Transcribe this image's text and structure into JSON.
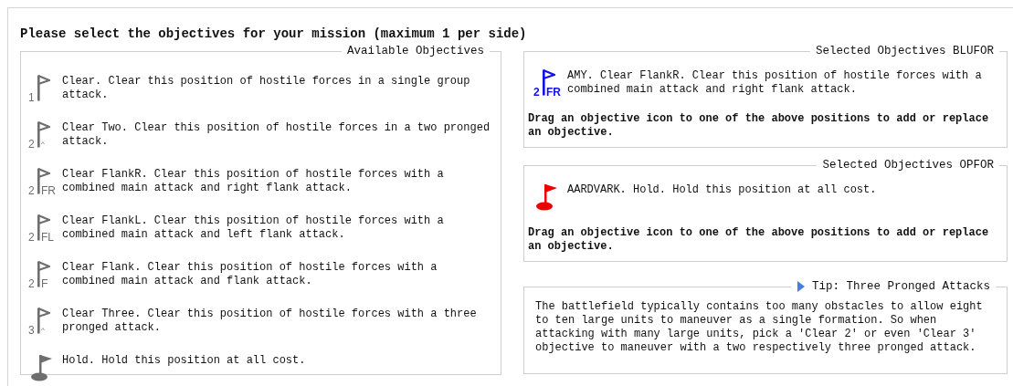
{
  "title": "Please select the objectives for your mission (maximum 1 per side)",
  "available": {
    "legend": "Available Objectives",
    "items": [
      {
        "kind": "clear",
        "number": "1",
        "text": "Clear. Clear this position of hostile forces in a single group attack."
      },
      {
        "kind": "clear",
        "number": "2",
        "suffix": "^",
        "text": "Clear Two. Clear this position of hostile forces in a two pronged attack."
      },
      {
        "kind": "clear",
        "number": "2",
        "suffix": "FR",
        "text": "Clear FlankR. Clear this position of hostile forces with a combined main attack and right flank attack."
      },
      {
        "kind": "clear",
        "number": "2",
        "suffix": "FL",
        "text": "Clear FlankL. Clear this position of hostile forces with a combined main attack and left flank attack."
      },
      {
        "kind": "clear",
        "number": "2",
        "suffix": "F",
        "text": "Clear Flank. Clear this position of hostile forces with a combined main attack and flank attack."
      },
      {
        "kind": "clear",
        "number": "3",
        "suffix": "^",
        "text": "Clear Three. Clear this position of hostile forces with a three pronged attack."
      },
      {
        "kind": "hold",
        "text": "Hold. Hold this position at all cost."
      }
    ]
  },
  "sides": [
    {
      "legend": "Selected Objectives BLUFOR",
      "items": [
        {
          "kind": "clear",
          "number": "2",
          "suffix": "FR",
          "color": "#1010e8",
          "text": "AMY. Clear FlankR. Clear this position of hostile forces with a combined main attack and right flank attack."
        }
      ],
      "hint": "Drag an objective icon to one of the above positions to add or replace an objective."
    },
    {
      "legend": "Selected Objectives OPFOR",
      "items": [
        {
          "kind": "hold",
          "color": "#ee0000",
          "text": "AARDVARK. Hold. Hold this position at all cost."
        }
      ],
      "hint": "Drag an objective icon to one of the above positions to add or replace an objective."
    }
  ],
  "tip": {
    "legend": "Tip: Three Pronged Attacks",
    "text": "The battlefield typically contains too many obstacles to allow eight to ten large units to maneuver as a single formation. So when attacking with many large units, pick a 'Clear 2' or even 'Clear 3' objective to maneuver with a two respectively three pronged attack."
  }
}
